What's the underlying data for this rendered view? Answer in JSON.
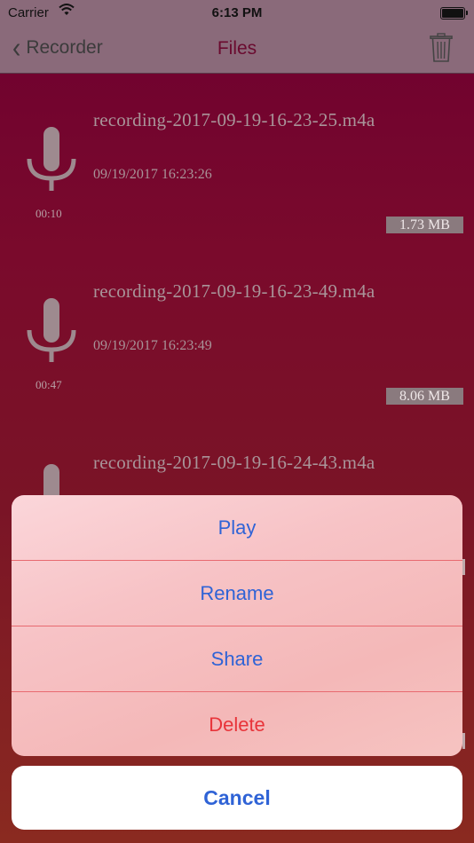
{
  "status_bar": {
    "carrier": "Carrier",
    "time": "6:13 PM"
  },
  "nav": {
    "back_label": "Recorder",
    "title": "Files"
  },
  "recordings": [
    {
      "name": "recording-2017-09-19-16-23-25.m4a",
      "date": "09/19/2017 16:23:26",
      "duration": "00:10",
      "size": "1.73 MB"
    },
    {
      "name": "recording-2017-09-19-16-23-49.m4a",
      "date": "09/19/2017 16:23:49",
      "duration": "00:47",
      "size": "8.06 MB"
    },
    {
      "name": "recording-2017-09-19-16-24-43.m4a"
    }
  ],
  "action_sheet": {
    "play": "Play",
    "rename": "Rename",
    "share": "Share",
    "delete": "Delete",
    "cancel": "Cancel"
  },
  "colors": {
    "accent": "#2f63d6",
    "destructive": "#e8343a",
    "title": "#6a0a2f"
  },
  "icons": {
    "back": "chevron-left-icon",
    "trash": "trash-icon",
    "mic": "microphone-icon",
    "wifi": "wifi-icon",
    "battery": "battery-icon"
  }
}
